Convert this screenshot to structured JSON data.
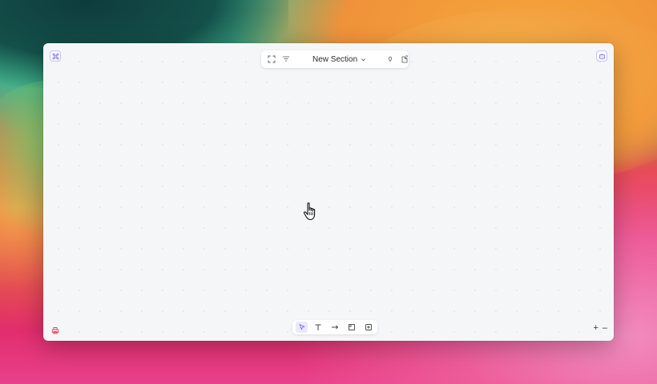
{
  "wallpaper": {
    "name": "desktop-wallpaper"
  },
  "window": {
    "top_left_icon": "command-icon",
    "top_right_icon": "robot-icon",
    "top_toolbar": {
      "icons": [
        "fullscreen-icon",
        "filter-icon"
      ],
      "section_title": "New Section",
      "section_chevron": "chevron-down-icon",
      "right_icons": [
        "lightbulb-icon",
        "export-icon"
      ]
    },
    "bottom_toolbar": {
      "tools": [
        {
          "icon": "pointer-tool-icon",
          "active": true
        },
        {
          "icon": "text-tool-icon",
          "active": false
        },
        {
          "icon": "arrow-tool-icon",
          "active": false
        },
        {
          "icon": "frame-tool-icon",
          "active": false
        },
        {
          "icon": "add-tool-icon",
          "active": false
        }
      ]
    },
    "bottom_left_icon": "printer-icon",
    "zoom": {
      "in_label": "+",
      "out_label": "–"
    }
  },
  "colors": {
    "accent": "#7b6ee6",
    "canvas_bg": "#f5f6f8",
    "printer_red": "#e0455a"
  },
  "cursor": "hand-pointer-icon"
}
